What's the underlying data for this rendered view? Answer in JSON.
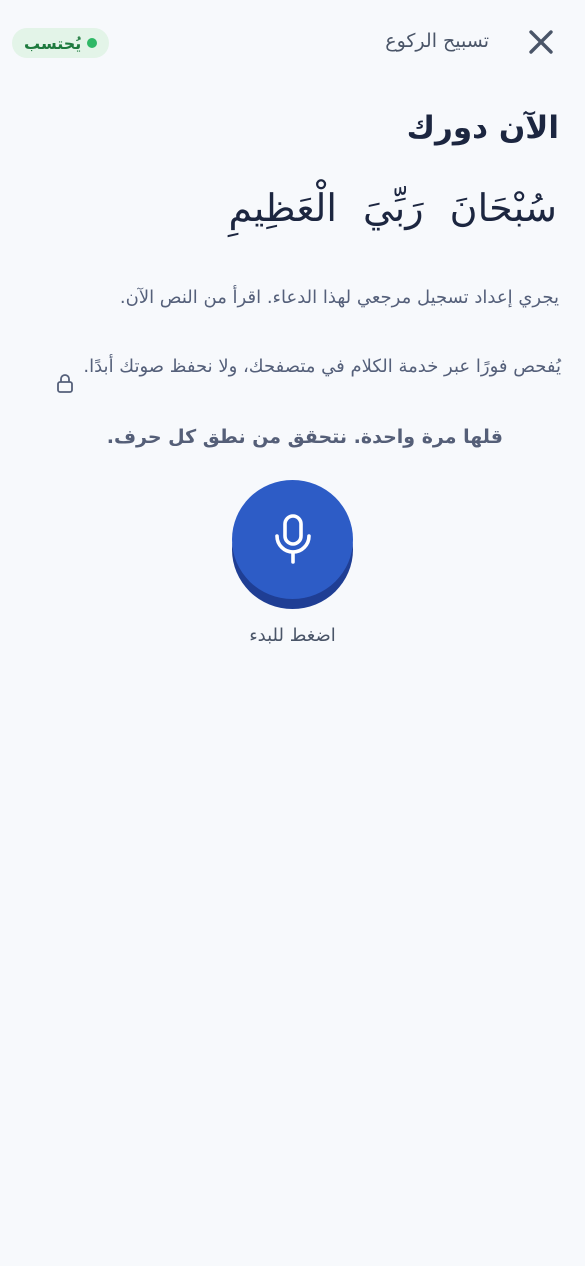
{
  "header": {
    "title": "تسبيح الركوع",
    "close_icon": "close-icon",
    "status_badge": {
      "label": "يُحتسب",
      "dot_color": "#2fb866"
    }
  },
  "main": {
    "heading": "الآن دورك",
    "dua_text": "سُبْحَانَ رَبِّيَ الْعَظِيمِ",
    "instruction": "يجري إعداد تسجيل مرجعي لهذا الدعاء. اقرأ من النص الآن.",
    "privacy_note": "يُفحص فورًا عبر خدمة الكلام في متصفحك، ولا نحفظ صوتك أبدًا.",
    "privacy_icon": "lock-icon",
    "once_note": "قلها مرة واحدة. نتحقق من نطق كل حرف.",
    "mic": {
      "icon": "microphone-icon",
      "label": "اضغط للبدء",
      "color": "#2d5cc6"
    }
  }
}
